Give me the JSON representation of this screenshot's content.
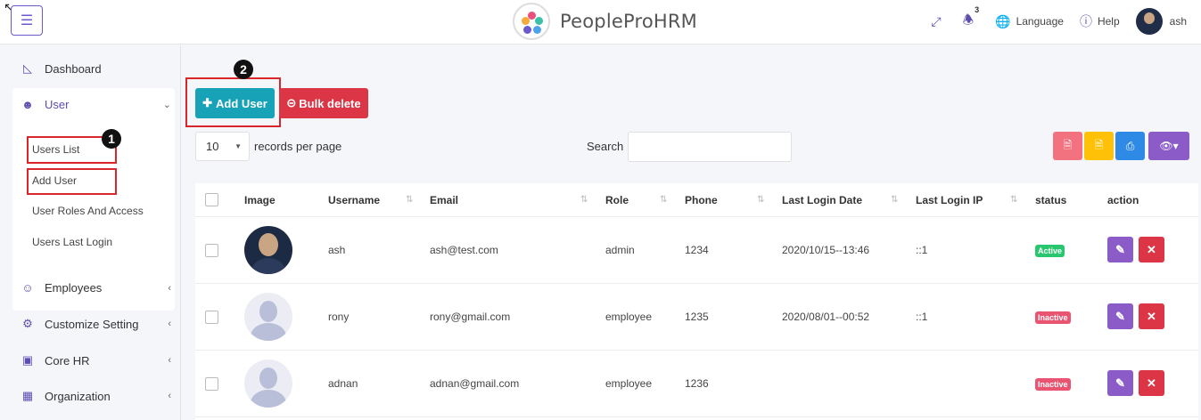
{
  "header": {
    "menu_icon": "hamburger-icon",
    "app_title": "PeopleProHRM",
    "notification_count": "3",
    "language_label": "Language",
    "help_label": "Help",
    "user_name": "ash"
  },
  "sidebar": {
    "dashboard": "Dashboard",
    "user": "User",
    "user_sub": [
      "Users List",
      "Add User",
      "User Roles And Access",
      "Users Last Login"
    ],
    "employees": "Employees",
    "customize": "Customize Setting",
    "corehr": "Core HR",
    "organization": "Organization"
  },
  "annotations": {
    "step1": "1",
    "step2": "2"
  },
  "toolbar": {
    "add_user": "Add User",
    "bulk_delete": "Bulk delete",
    "page_size": "10",
    "records_label": "records per page",
    "search_label": "Search",
    "search_value": ""
  },
  "colors": {
    "accent": "#5c4db1",
    "add_btn": "#17a2b8",
    "delete_btn": "#dc3545",
    "pdf_btn": "#f3727f",
    "csv_btn": "#ffc107",
    "print_btn": "#2f8ae5",
    "col_btn": "#8b5cc8",
    "active": "#28c76f",
    "inactive": "#ea5470"
  },
  "table": {
    "headers": [
      "Image",
      "Username",
      "Email",
      "Role",
      "Phone",
      "Last Login Date",
      "Last Login IP",
      "status",
      "action"
    ],
    "rows": [
      {
        "username": "ash",
        "email": "ash@test.com",
        "role": "admin",
        "phone": "1234",
        "last_login": "2020/10/15--13:46",
        "ip": "::1",
        "status": "Active",
        "avatar": "photo"
      },
      {
        "username": "rony",
        "email": "rony@gmail.com",
        "role": "employee",
        "phone": "1235",
        "last_login": "2020/08/01--00:52",
        "ip": "::1",
        "status": "Inactive",
        "avatar": "placeholder"
      },
      {
        "username": "adnan",
        "email": "adnan@gmail.com",
        "role": "employee",
        "phone": "1236",
        "last_login": "",
        "ip": "",
        "status": "Inactive",
        "avatar": "placeholder"
      }
    ]
  }
}
